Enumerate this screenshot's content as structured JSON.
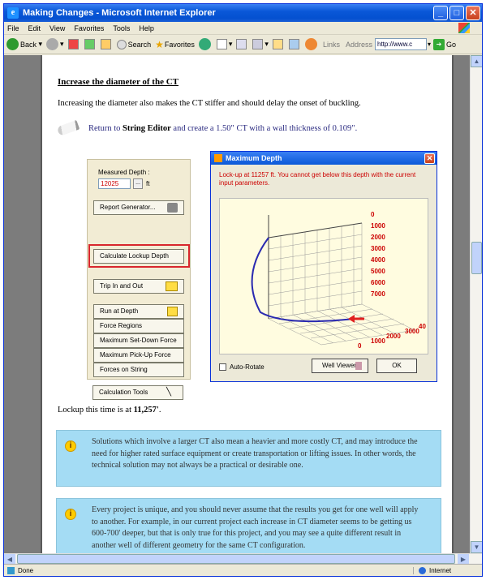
{
  "window": {
    "title": "Making Changes - Microsoft Internet Explorer",
    "minimize": "_",
    "maximize": "□",
    "close": "✕"
  },
  "menu": [
    "File",
    "Edit",
    "View",
    "Favorites",
    "Tools",
    "Help"
  ],
  "toolbar": {
    "back": "Back",
    "search": "Search",
    "favorites": "Favorites",
    "links": "Links",
    "address_label": "Address",
    "address_value": "http://www.c",
    "go": "Go"
  },
  "page": {
    "heading": "Increase the diameter of the CT",
    "para1": "Increasing the diameter also makes the CT stiffer and should delay the onset of buckling.",
    "return_prefix": "Return to",
    "return_target": "String Editor",
    "return_suffix": "and create a 1.50\" CT with a wall thickness of 0.109\".",
    "lockup_prefix": "Lockup this time is at",
    "lockup_value": "11,257'",
    "lockup_suffix": "."
  },
  "panel": {
    "measured_depth_label": "Measured Depth :",
    "measured_depth_value": "12025",
    "unit": "ft",
    "buttons": [
      "Report Generator...",
      "Calculate Lockup Depth",
      "Trip In and Out",
      "Run at Depth",
      "Force Regions",
      "Maximum Set-Down Force",
      "Maximum Pick-Up Force",
      "Forces on String",
      "Calculation Tools"
    ]
  },
  "dialog": {
    "title": "Maximum Depth",
    "message": "Lock-up at 11257 ft. You cannot get below this depth with the current input parameters.",
    "depth_ticks": [
      "0",
      "1000",
      "2000",
      "3000",
      "4000",
      "5000",
      "6000",
      "7000"
    ],
    "x_ticks": [
      "0",
      "1000",
      "2000",
      "3000",
      "40"
    ],
    "auto_rotate": "Auto-Rotate",
    "well_viewer": "Well Viewer",
    "ok": "OK"
  },
  "notes": [
    "Solutions which involve a larger CT also mean a heavier and more costly CT, and may introduce the need for higher rated surface equipment or create transportation or lifting issues. In other words, the technical solution may not always be a practical or desirable one.",
    "Every project is unique, and you should never assume that the results you get for one well will apply to another. For example, in our current project each increase in CT diameter seems to be getting us 600-700' deeper, but that is only true for this project, and you may see a quite different result in another well of different geometry for the same CT configuration."
  ],
  "note_icon": "i",
  "status": {
    "left": "Done",
    "zone": "Internet"
  },
  "colors": {
    "note_bg": "#a4dcf4",
    "highlight": "#d8272d",
    "title_blue": "#0a58d8",
    "plot_curve": "#2a2ab0",
    "lockup_arrow": "#e02020",
    "tick_red": "#cc0000"
  }
}
